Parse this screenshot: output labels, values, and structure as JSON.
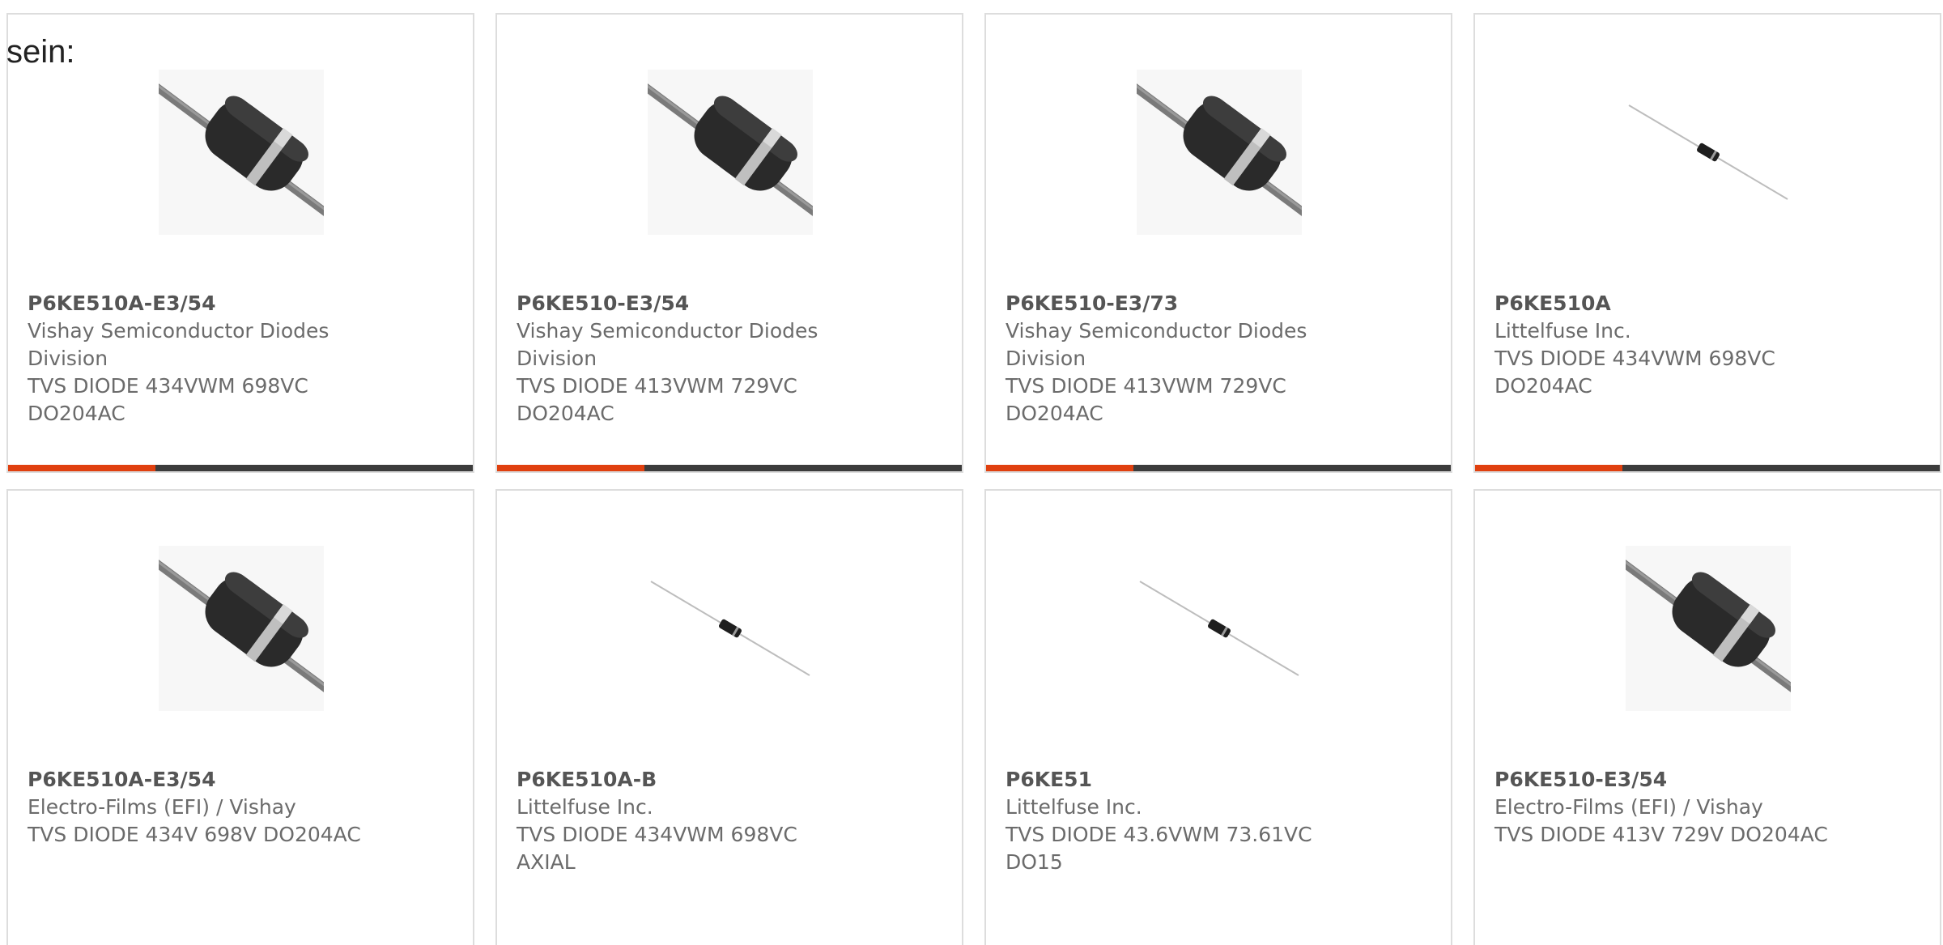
{
  "intro_text": "sein:",
  "accent_color": "#e0400f",
  "cards": [
    {
      "part": "P6KE510A-E3/54",
      "manufacturer": "Vishay Semiconductor Diodes",
      "manufacturer_cont": "Division",
      "desc1": "TVS DIODE 434VWM 698VC",
      "desc2": "DO204AC",
      "image": "diode-closeup-image"
    },
    {
      "part": "P6KE510-E3/54",
      "manufacturer": "Vishay Semiconductor Diodes",
      "manufacturer_cont": "Division",
      "desc1": "TVS DIODE 413VWM 729VC",
      "desc2": "DO204AC",
      "image": "diode-closeup-image"
    },
    {
      "part": "P6KE510-E3/73",
      "manufacturer": "Vishay Semiconductor Diodes",
      "manufacturer_cont": "Division",
      "desc1": "TVS DIODE 413VWM 729VC",
      "desc2": "DO204AC",
      "image": "diode-closeup-image"
    },
    {
      "part": "P6KE510A",
      "manufacturer": "Littelfuse Inc.",
      "manufacturer_cont": "",
      "desc1": "TVS DIODE 434VWM 698VC",
      "desc2": "DO204AC",
      "image": "diode-axial-image"
    },
    {
      "part": "P6KE510A-E3/54",
      "manufacturer": "Electro-Films (EFI) / Vishay",
      "manufacturer_cont": "",
      "desc1": "TVS DIODE 434V 698V DO204AC",
      "desc2": "",
      "image": "diode-closeup-image"
    },
    {
      "part": "P6KE510A-B",
      "manufacturer": "Littelfuse Inc.",
      "manufacturer_cont": "",
      "desc1": "TVS DIODE 434VWM 698VC",
      "desc2": "AXIAL",
      "image": "diode-axial-image"
    },
    {
      "part": "P6KE51",
      "manufacturer": "Littelfuse Inc.",
      "manufacturer_cont": "",
      "desc1": "TVS DIODE 43.6VWM 73.61VC",
      "desc2": "DO15",
      "image": "diode-axial-image"
    },
    {
      "part": "P6KE510-E3/54",
      "manufacturer": "Electro-Films (EFI) / Vishay",
      "manufacturer_cont": "",
      "desc1": "TVS DIODE 413V 729V DO204AC",
      "desc2": "",
      "image": "diode-closeup-image"
    }
  ]
}
